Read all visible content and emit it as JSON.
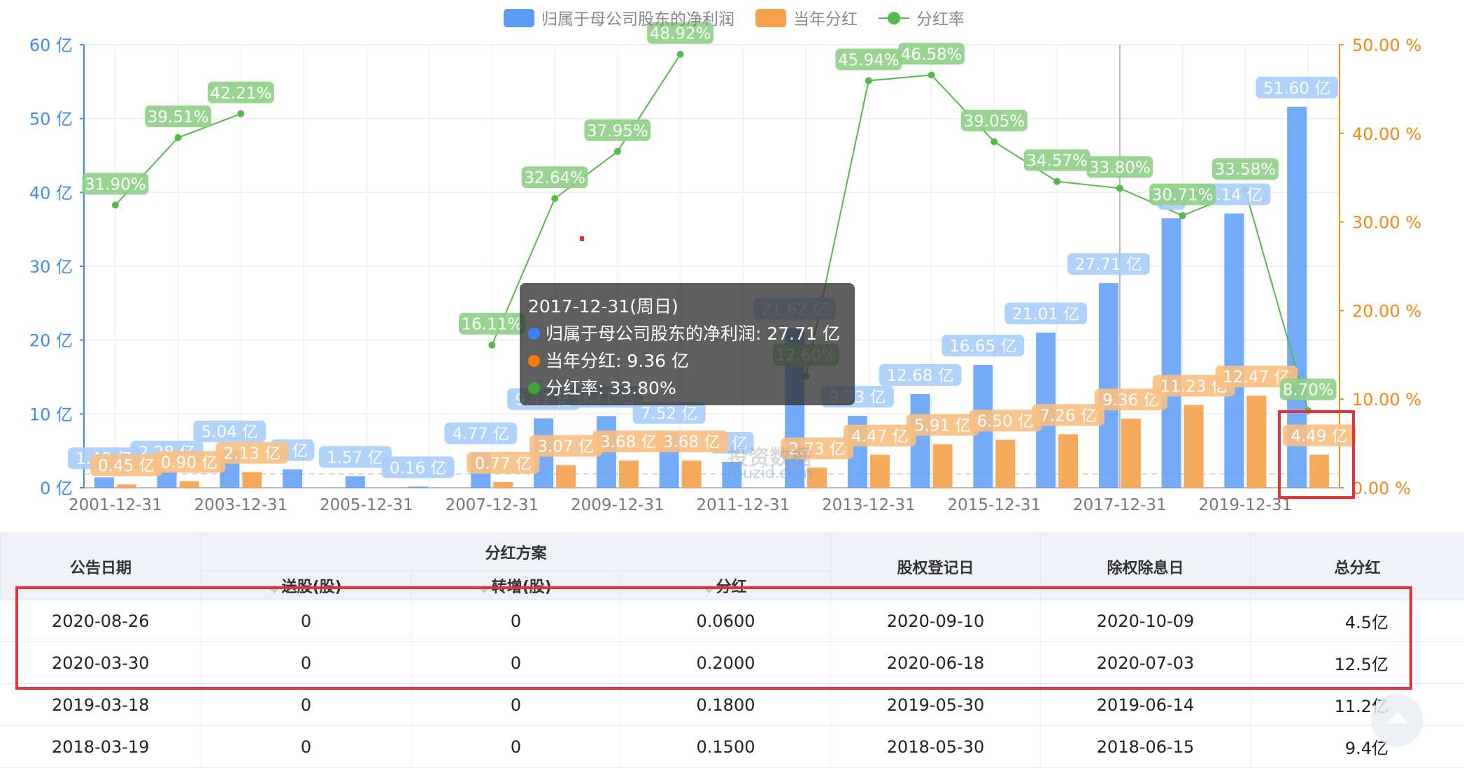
{
  "chart_data": {
    "type": "bar",
    "title": "",
    "legend": [
      "归属于母公司股东的净利润",
      "当年分红",
      "分红率"
    ],
    "legend_position": "top-center",
    "x": [
      "2001-12-31",
      "2002-12-31",
      "2003-12-31",
      "2004-12-31",
      "2005-12-31",
      "2006-12-31",
      "2007-12-31",
      "2008-12-31",
      "2009-12-31",
      "2010-12-31",
      "2011-12-31",
      "2012-12-31",
      "2013-12-31",
      "2014-12-31",
      "2015-12-31",
      "2016-12-31",
      "2017-12-31",
      "2018-12-31",
      "2019-12-31",
      "2020-12-31"
    ],
    "x_ticks": [
      "2001-12-31",
      "2003-12-31",
      "2005-12-31",
      "2007-12-31",
      "2009-12-31",
      "2011-12-31",
      "2013-12-31",
      "2015-12-31",
      "2017-12-31",
      "2019-12-31"
    ],
    "y_left_ticks": [
      "0 亿",
      "10 亿",
      "20 亿",
      "30 亿",
      "40 亿",
      "50 亿",
      "60 亿"
    ],
    "y_right_ticks": [
      "0.00 %",
      "10.00 %",
      "20.00 %",
      "30.00 %",
      "40.00 %",
      "50.00 %"
    ],
    "ylim_left": [
      0,
      60
    ],
    "ylim_right": [
      0,
      50
    ],
    "series": [
      {
        "name": "归属于母公司股东的净利润",
        "type": "bar",
        "color": "#5b9cf7",
        "values": [
          1.4,
          2.28,
          5.04,
          2.5,
          1.57,
          0.16,
          4.77,
          9.41,
          9.71,
          7.52,
          3.5,
          21.62,
          9.73,
          12.68,
          16.65,
          21.01,
          27.71,
          36.5,
          37.14,
          51.6
        ],
        "labels": [
          "1.40 亿",
          "2.28 亿",
          "5.04 亿",
          "5 亿",
          "1.57 亿",
          "0.16 亿",
          "4.77 亿",
          "9.41 亿",
          "9.71 亿",
          "7.52 亿",
          "5 亿",
          "21.62 亿",
          "9.73 亿",
          "12.68 亿",
          "16.65 亿",
          "21.01 亿",
          "27.71 亿",
          "36",
          "7.14 亿",
          "51.60 亿"
        ]
      },
      {
        "name": "当年分红",
        "type": "bar",
        "color": "#f5a14a",
        "values": [
          0.45,
          0.9,
          2.13,
          null,
          null,
          null,
          0.77,
          3.07,
          3.68,
          3.68,
          null,
          2.73,
          4.47,
          5.91,
          6.5,
          7.26,
          9.36,
          11.23,
          12.47,
          4.49
        ],
        "labels": [
          "0.45 亿",
          "0.90 亿",
          "2.13 亿",
          null,
          null,
          null,
          "0.77 亿",
          "3.07 亿",
          "3.68 亿",
          "3.68 亿",
          null,
          "2.73 亿",
          "4.47 亿",
          "5.91 亿",
          "6.50 亿",
          "7.26 亿",
          "9.36 亿",
          "11.23 亿",
          "12.47 亿",
          "4.49 亿"
        ]
      },
      {
        "name": "分红率",
        "type": "line",
        "axis": "right",
        "color": "#55b94c",
        "values": [
          31.9,
          39.51,
          42.21,
          null,
          null,
          null,
          16.11,
          32.64,
          37.95,
          48.92,
          null,
          12.6,
          45.94,
          46.58,
          39.05,
          34.57,
          33.8,
          30.71,
          33.58,
          8.7
        ],
        "labels": [
          "31.90%",
          "39.51%",
          "42.21%",
          null,
          null,
          null,
          "16.11%",
          "32.64%",
          "37.95%",
          "48.92%",
          null,
          "12.60%",
          "45.94%",
          "46.58%",
          "39.05%",
          "34.57%",
          "33.80%",
          "30.71%",
          "33.58%",
          "8.70%"
        ]
      }
    ]
  },
  "tooltip": {
    "title": "2017-12-31(周日)",
    "rows": [
      {
        "label": "归属于母公司股东的净利润: 27.71 亿",
        "color": "#3b82f6"
      },
      {
        "label": "当年分红: 9.36 亿",
        "color": "#f57c00"
      },
      {
        "label": "分红率: 33.80%",
        "color": "#3aa635"
      }
    ]
  },
  "watermark": {
    "text": "投资数据",
    "sub": "touzid.com"
  },
  "table": {
    "headers": {
      "date": "公告日期",
      "plan": "分红方案",
      "song": "送股(股)",
      "zhuan": "转增(股)",
      "fenhong": "分红",
      "reg": "股权登记日",
      "ex": "除权除息日",
      "total": "总分红"
    },
    "rows": [
      [
        "2020-08-26",
        "0",
        "0",
        "0.0600",
        "2020-09-10",
        "2020-10-09",
        "4.5亿"
      ],
      [
        "2020-03-30",
        "0",
        "0",
        "0.2000",
        "2020-06-18",
        "2020-07-03",
        "12.5亿"
      ],
      [
        "2019-03-18",
        "0",
        "0",
        "0.1800",
        "2019-05-30",
        "2019-06-14",
        "11.2亿"
      ],
      [
        "2018-03-19",
        "0",
        "0",
        "0.1500",
        "2018-05-30",
        "2018-06-15",
        "9.4亿"
      ]
    ]
  }
}
